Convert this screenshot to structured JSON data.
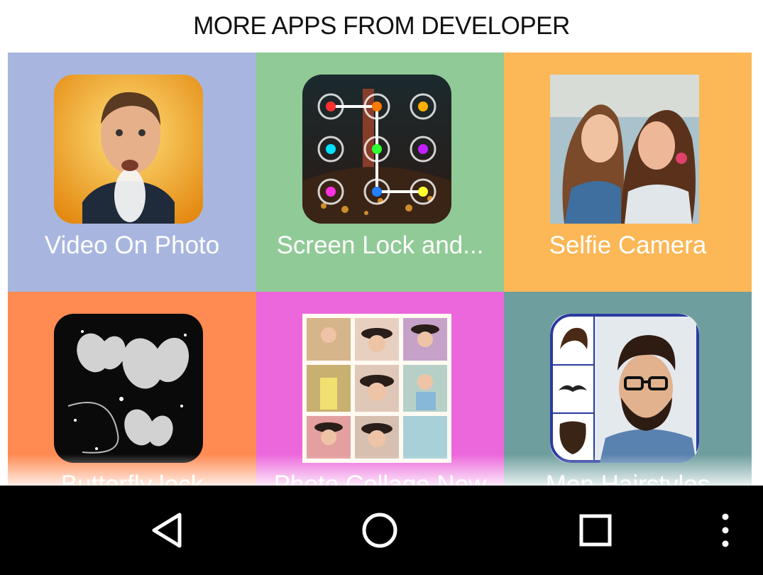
{
  "header": {
    "title": "MORE APPS FROM DEVELOPER"
  },
  "apps": [
    {
      "label": "Video On Photo",
      "bg": "#a8b6df",
      "icon": "man-with-smoke-icon"
    },
    {
      "label": "Screen Lock and...",
      "bg": "#90ca96",
      "icon": "pattern-lock-icon"
    },
    {
      "label": "Selfie Camera",
      "bg": "#fcb756",
      "icon": "selfie-girls-icon"
    },
    {
      "label": "Butterfly lock",
      "bg": "#ff8a52",
      "icon": "butterfly-icon"
    },
    {
      "label": "Photo Collage New",
      "bg": "#ec67dc",
      "icon": "collage-icon"
    },
    {
      "label": "Men Hairstyles",
      "bg": "#6f9e9e",
      "icon": "bearded-man-icon"
    }
  ],
  "navbar": {
    "back": "back-icon",
    "home": "home-icon",
    "recents": "recents-icon",
    "menu": "overflow-menu-icon"
  }
}
